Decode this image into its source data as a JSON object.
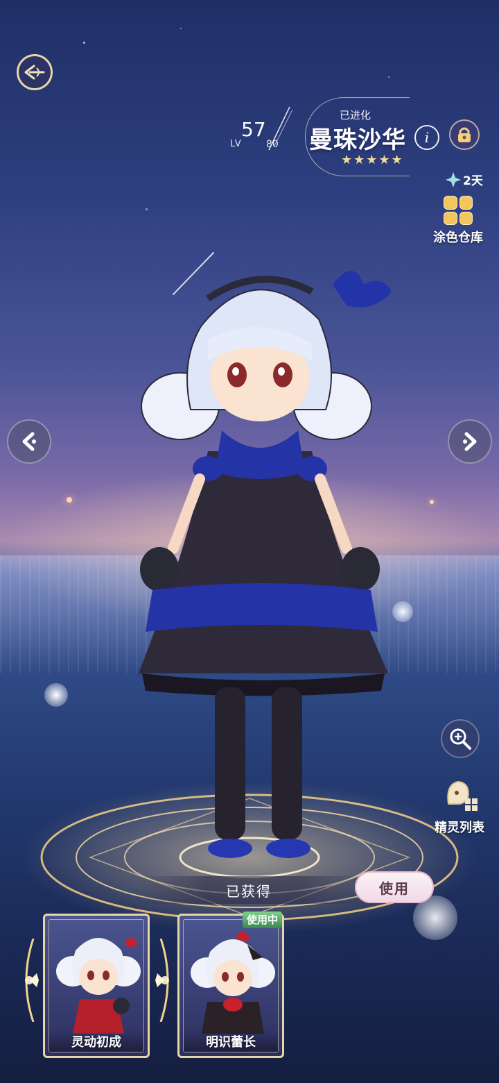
{
  "pet": {
    "evolved_label": "已进化",
    "name": "曼珠沙华",
    "level": "57",
    "level_label": "LV",
    "max_level": "80",
    "stars": "★★★★★",
    "star_count": 5
  },
  "right_panel": {
    "timer_text": "2天",
    "paint_warehouse_label": "涂色仓库",
    "spirit_list_label": "精灵列表"
  },
  "outfit_action": {
    "status_text": "已获得",
    "use_button_label": "使用"
  },
  "outfits": [
    {
      "label": "灵动初成"
    },
    {
      "label": "明识蕾长",
      "tag": "使用中"
    }
  ],
  "icons": {
    "back": "back-arrow-icon",
    "info": "info-icon",
    "lock": "lock-icon",
    "timer": "diamond-icon",
    "paint": "palette-grid-icon",
    "prev": "chevron-left-icon",
    "next": "chevron-right-icon",
    "zoom": "magnifier-icon",
    "spirit_list": "spirit-list-icon"
  },
  "colors": {
    "gold": "#e6d7aa",
    "use_button_bg": "#f6e6ee",
    "in_use_tag": "#4aa060",
    "sky_top": "#1f2f66"
  }
}
